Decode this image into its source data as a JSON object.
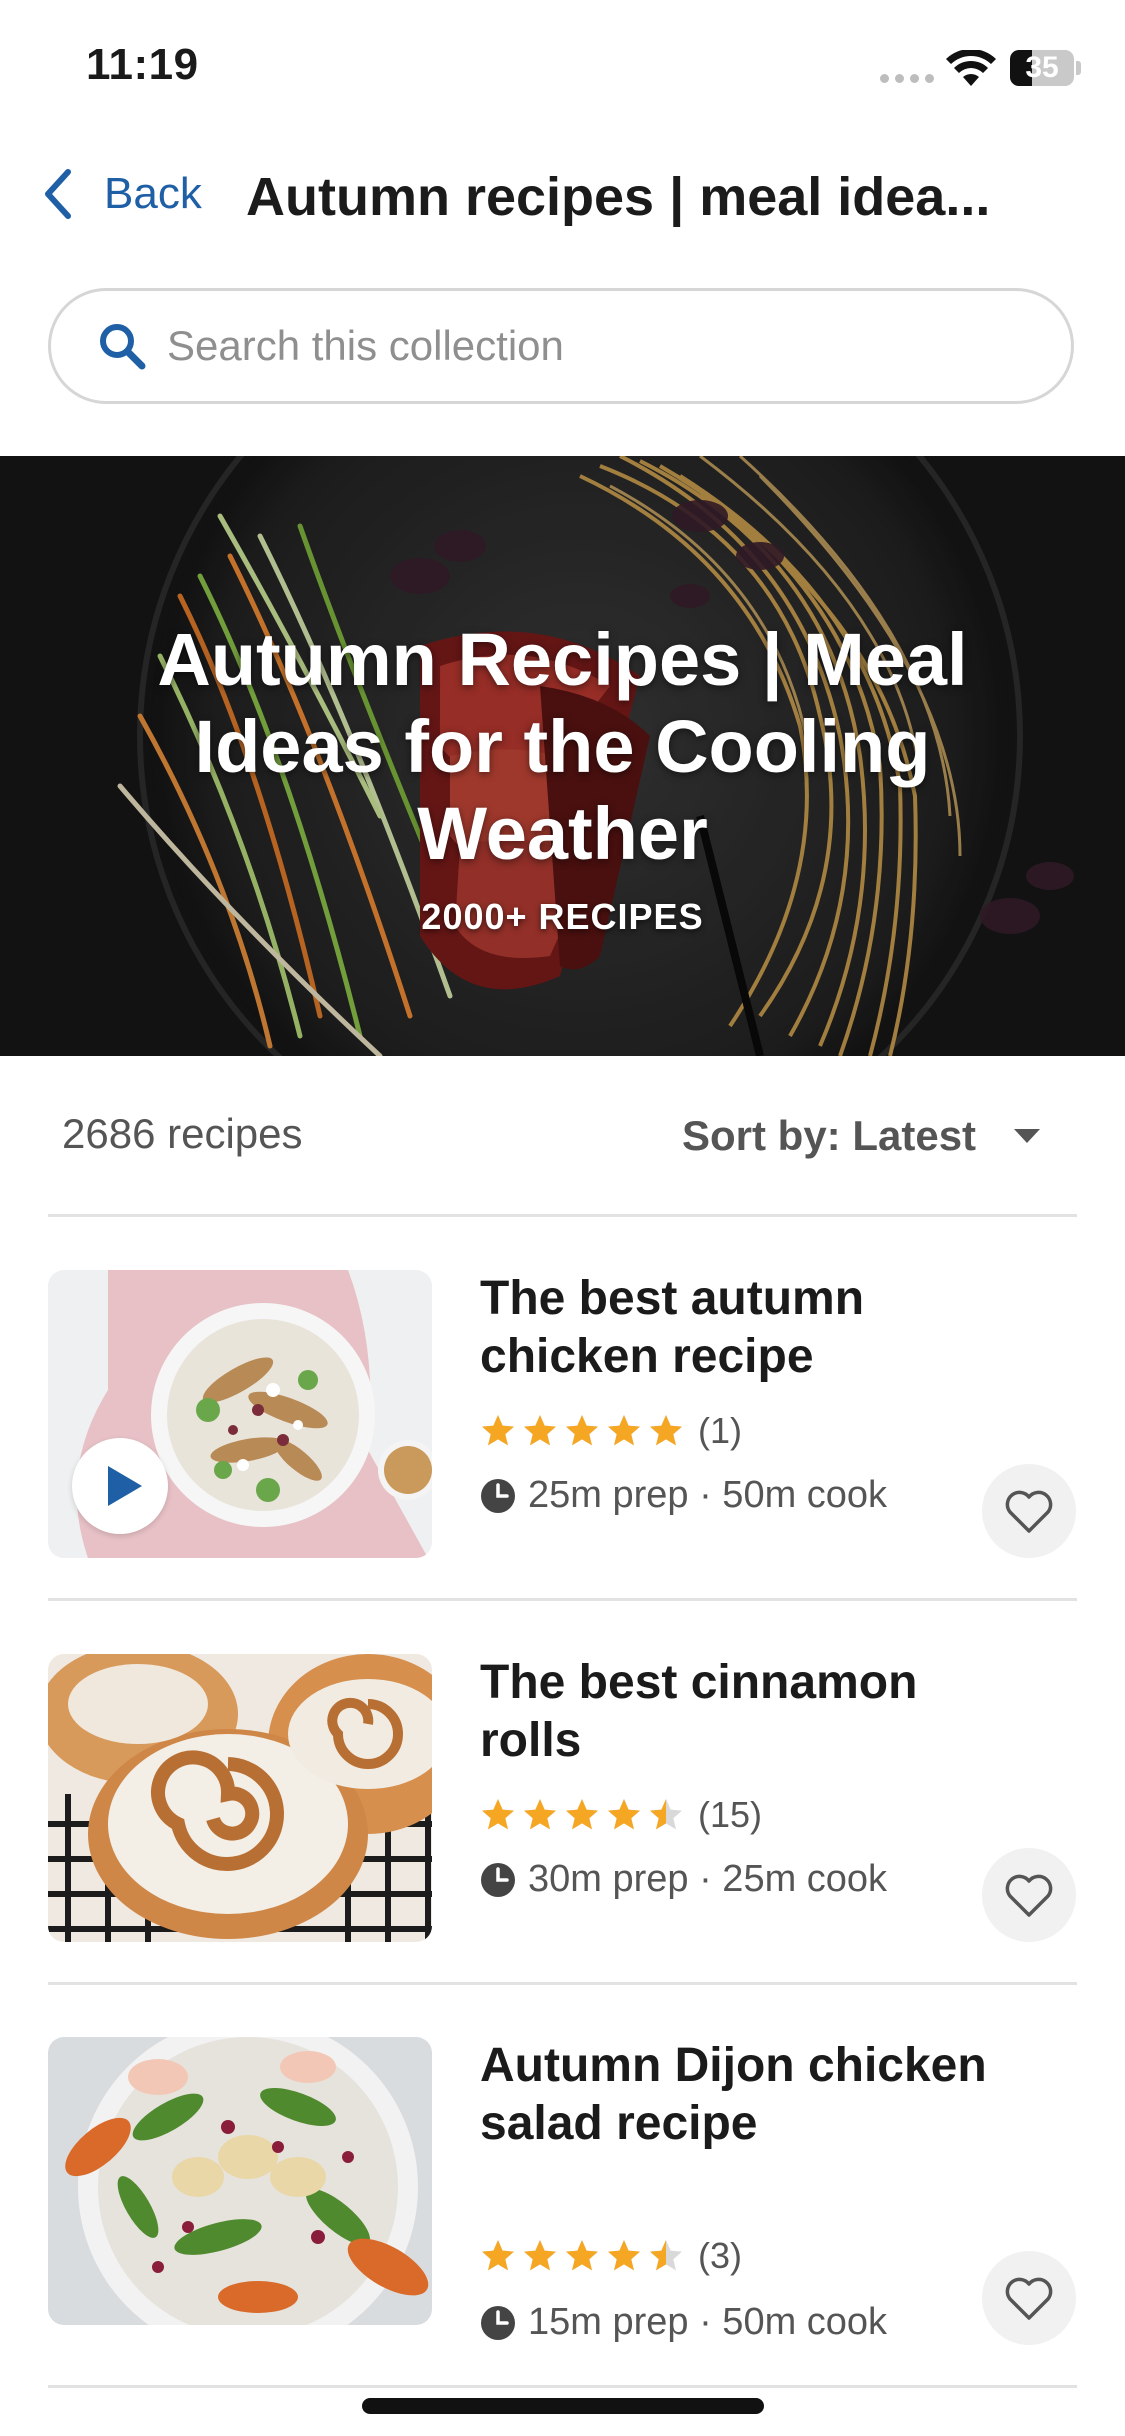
{
  "status_bar": {
    "time": "11:19",
    "battery_level": "35",
    "battery_fraction": 0.35
  },
  "nav": {
    "back_label": "Back",
    "title": "Autumn recipes | meal idea..."
  },
  "search": {
    "placeholder": "Search this collection"
  },
  "hero": {
    "title": "Autumn Recipes | Meal Ideas for the Cooling Weather",
    "subtitle": "2000+ RECIPES"
  },
  "toolbar": {
    "count": "2686 recipes",
    "sort_label": "Sort by: Latest"
  },
  "recipes": [
    {
      "title": "The best autumn chicken recipe",
      "rating": 5,
      "rating_count": "(1)",
      "time": "25m prep · 50m cook",
      "has_video": true
    },
    {
      "title": "The best cinnamon rolls",
      "rating": 4.5,
      "rating_count": "(15)",
      "time": "30m prep · 25m cook",
      "has_video": false
    },
    {
      "title": "Autumn Dijon chicken salad recipe",
      "rating": 4.5,
      "rating_count": "(3)",
      "time": "15m prep · 50m cook",
      "has_video": false
    }
  ],
  "colors": {
    "accent": "#1f5fa6",
    "star": "#f5a623",
    "star_empty": "#d9d9d9"
  }
}
